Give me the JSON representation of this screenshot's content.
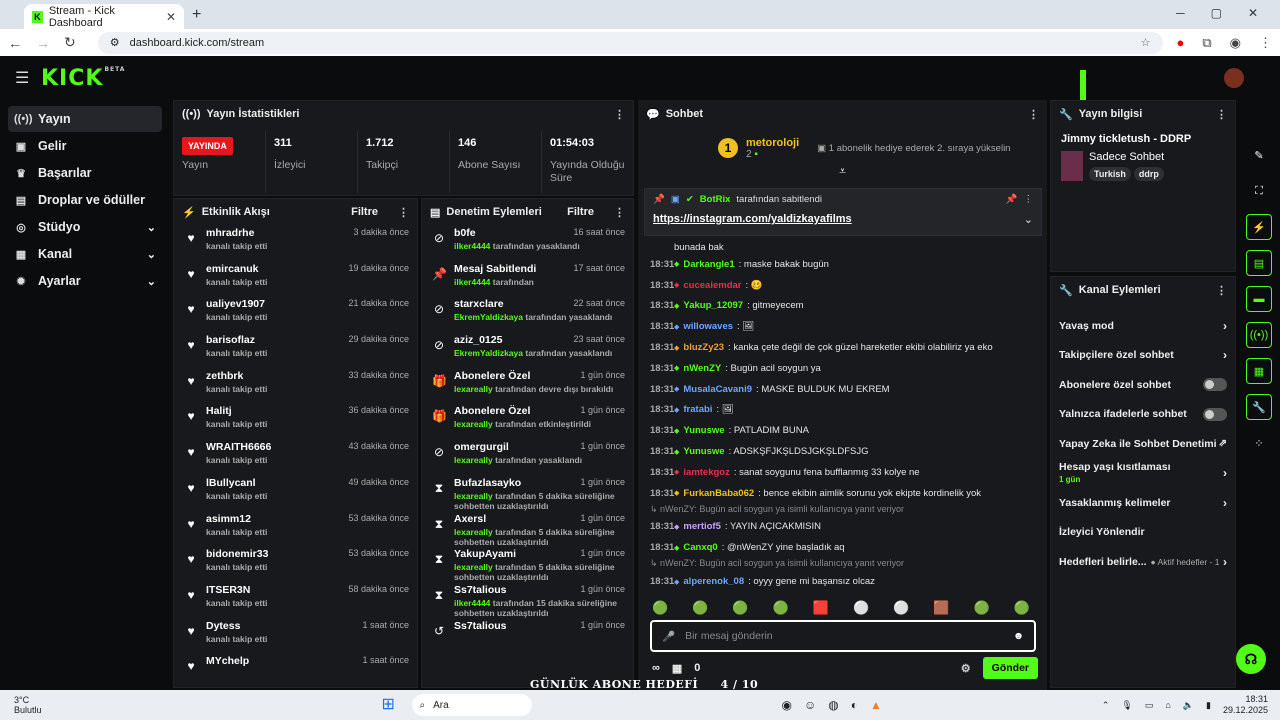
{
  "browser": {
    "tab_title": "Stream - Kick Dashboard",
    "url": "dashboard.kick.com/stream"
  },
  "brand": {
    "logo": "KICK",
    "beta": "BETA",
    "accent": "#53fc18"
  },
  "sidebar": {
    "items": [
      {
        "label": "Yayın",
        "icon": "broadcast-icon"
      },
      {
        "label": "Gelir",
        "icon": "money-icon"
      },
      {
        "label": "Başarılar",
        "icon": "trophy-icon"
      },
      {
        "label": "Droplar ve ödüller",
        "icon": "gift-icon"
      },
      {
        "label": "Stüdyo",
        "icon": "studio-icon"
      },
      {
        "label": "Kanal",
        "icon": "channel-icon"
      },
      {
        "label": "Ayarlar",
        "icon": "gear-icon"
      }
    ]
  },
  "stats_panel": {
    "title": "Yayın İstatistikleri",
    "live_badge": "YAYINDA",
    "live_label": "Yayın",
    "stats": [
      {
        "value": "311",
        "label": "İzleyici"
      },
      {
        "value": "1.712",
        "label": "Takipçi"
      },
      {
        "value": "146",
        "label": "Abone Sayısı"
      },
      {
        "value": "01:54:03",
        "label": "Yayında Olduğu Süre"
      }
    ]
  },
  "activity_feed": {
    "title": "Etkinlik Akışı",
    "filter": "Filtre",
    "items": [
      {
        "name": "mhradrhe",
        "sub": "kanalı takip etti",
        "time": "3 dakika önce"
      },
      {
        "name": "emircanuk",
        "sub": "kanalı takip etti",
        "time": "19 dakika önce"
      },
      {
        "name": "ualiyev1907",
        "sub": "kanalı takip etti",
        "time": "21 dakika önce"
      },
      {
        "name": "barisoflaz",
        "sub": "kanalı takip etti",
        "time": "29 dakika önce"
      },
      {
        "name": "zethbrk",
        "sub": "kanalı takip etti",
        "time": "33 dakika önce"
      },
      {
        "name": "Halitj",
        "sub": "kanalı takip etti",
        "time": "36 dakika önce"
      },
      {
        "name": "WRAITH6666",
        "sub": "kanalı takip etti",
        "time": "43 dakika önce"
      },
      {
        "name": "lBullycanl",
        "sub": "kanalı takip etti",
        "time": "49 dakika önce"
      },
      {
        "name": "asimm12",
        "sub": "kanalı takip etti",
        "time": "53 dakika önce"
      },
      {
        "name": "bidonemir33",
        "sub": "kanalı takip etti",
        "time": "53 dakika önce"
      },
      {
        "name": "ITSER3N",
        "sub": "kanalı takip etti",
        "time": "58 dakika önce"
      },
      {
        "name": "Dytess",
        "sub": "kanalı takip etti",
        "time": "1 saat önce"
      },
      {
        "name": "MYchelp",
        "sub": "",
        "time": "1 saat önce"
      }
    ]
  },
  "mod_actions": {
    "title": "Denetim Eylemleri",
    "filter": "Filtre",
    "items": [
      {
        "name": "b0fe",
        "actor": "ilker4444",
        "action": "tarafından yasaklandı",
        "time": "16 saat önce",
        "icon": "ban-icon"
      },
      {
        "name": "Mesaj Sabitlendi",
        "actor": "ilker4444",
        "action": "tarafından",
        "time": "17 saat önce",
        "icon": "pin-icon"
      },
      {
        "name": "starxclare",
        "actor": "EkremYaldizkaya",
        "action": "tarafından yasaklandı",
        "time": "22 saat önce",
        "icon": "ban-icon"
      },
      {
        "name": "aziz_0125",
        "actor": "EkremYaldizkaya",
        "action": "tarafından yasaklandı",
        "time": "23 saat önce",
        "icon": "ban-icon"
      },
      {
        "name": "Abonelere Özel",
        "actor": "lexareally",
        "action": "tarafından devre dışı bırakıldı",
        "time": "1 gün önce",
        "icon": "gift-icon"
      },
      {
        "name": "Abonelere Özel",
        "actor": "lexareally",
        "action": "tarafından etkinleştirildi",
        "time": "1 gün önce",
        "icon": "gift-icon"
      },
      {
        "name": "omergurgil",
        "actor": "lexareally",
        "action": "tarafından yasaklandı",
        "time": "1 gün önce",
        "icon": "ban-icon"
      },
      {
        "name": "Bufazlasayko",
        "actor": "lexareally",
        "action": "tarafından 5 dakika süreliğine sohbetten uzaklaştırıldı",
        "time": "1 gün önce",
        "icon": "hourglass-icon"
      },
      {
        "name": "Axersl",
        "actor": "lexareally",
        "action": "tarafından 5 dakika süreliğine sohbetten uzaklaştırıldı",
        "time": "1 gün önce",
        "icon": "hourglass-icon"
      },
      {
        "name": "YakupAyami",
        "actor": "lexareally",
        "action": "tarafından 5 dakika süreliğine sohbetten uzaklaştırıldı",
        "time": "1 gün önce",
        "icon": "hourglass-icon"
      },
      {
        "name": "Ss7talious",
        "actor": "ilker4444",
        "action": "tarafından 15 dakika süreliğine sohbetten uzaklaştırıldı",
        "time": "1 gün önce",
        "icon": "hourglass-icon"
      },
      {
        "name": "Ss7talious",
        "actor": "",
        "action": "",
        "time": "1 gün önce",
        "icon": "undo-icon"
      }
    ]
  },
  "chat": {
    "title": "Sohbet",
    "top_sub": {
      "name": "metorolojі",
      "count": "2",
      "message": "1 abonelik hediye ederek 2. sıraya yükselin"
    },
    "pinned": {
      "by": "BotRix",
      "by_suffix": "tarafından sabitlendi",
      "link": "https://instagram.com/yaldizkayafilms"
    },
    "messages": [
      {
        "type": "msg",
        "time": "",
        "user": "",
        "color": "#e6e6e6",
        "text": "bunada bak"
      },
      {
        "type": "msg",
        "time": "18:31",
        "user": "Darkangle1",
        "color": "#53fc18",
        "text": ": maske bakak bugün"
      },
      {
        "type": "msg",
        "time": "18:31",
        "user": "cuceaiemdar",
        "color": "#e8304a",
        "text": ": 🥴"
      },
      {
        "type": "msg",
        "time": "18:31",
        "user": "Yakup_12097",
        "color": "#53fc18",
        "text": ": gitmeyecem"
      },
      {
        "type": "msg",
        "time": "18:31",
        "user": "willowaves",
        "color": "#6ea6ff",
        "text": ": 🖼"
      },
      {
        "type": "msg",
        "time": "18:31",
        "user": "bluzZy23",
        "color": "#f0a030",
        "text": ": kanka çete değil de çok güzel hareketler ekibi olabiliriz ya eko"
      },
      {
        "type": "msg",
        "time": "18:31",
        "user": "nWenZY",
        "color": "#53fc18",
        "text": ": Bugün acil soygun ya"
      },
      {
        "type": "msg",
        "time": "18:31",
        "user": "MusalaCavani9",
        "color": "#6ea6ff",
        "text": ": MASKE BULDUK MU EKREM"
      },
      {
        "type": "msg",
        "time": "18:31",
        "user": "fratabi",
        "color": "#6ea6ff",
        "text": ": 🖼"
      },
      {
        "type": "msg",
        "time": "18:31",
        "user": "Yunuswe",
        "color": "#53fc18",
        "text": ": PATLADIM BUNA"
      },
      {
        "type": "msg",
        "time": "18:31",
        "user": "Yunuswe",
        "color": "#53fc18",
        "text": ": ADSKŞFJKŞLDSJGKŞLDFSJG"
      },
      {
        "type": "msg",
        "time": "18:31",
        "user": "iamtekgoz",
        "color": "#e8304a",
        "text": ": sanat soygunu fena bufflanmış 33 kolye ne"
      },
      {
        "type": "msg",
        "time": "18:31",
        "user": "FurkanBaba062",
        "color": "#f0c020",
        "text": ": bence ekibin aimlik sorunu yok ekipte kordinelik yok"
      },
      {
        "type": "reply",
        "text": "↳ nWenZY: Bugün acil soygun ya isimli kullanıcıya yanıt veriyor"
      },
      {
        "type": "msg",
        "time": "18:31",
        "user": "mertiof5",
        "color": "#c8a0ff",
        "text": ": YAYIN AÇICAKMISIN"
      },
      {
        "type": "msg",
        "time": "18:31",
        "user": "Canxq0",
        "color": "#53fc18",
        "text": ": @nWenZY yine başladık aq"
      },
      {
        "type": "reply",
        "text": "↳ nWenZY: Bugün acil soygun ya isimli kullanıcıya yanıt veriyor"
      },
      {
        "type": "msg",
        "time": "18:31",
        "user": "alperenok_08",
        "color": "#6ea6ff",
        "text": ": oyyy gene mi başansız olcaz"
      }
    ],
    "emotes": [
      "🟢",
      "🟢",
      "🟢",
      "🟢",
      "🟥",
      "⚪",
      "⚪",
      "🟫",
      "🟢",
      "🟢"
    ],
    "input_placeholder": "Bir mesaj gönderin",
    "points": "0",
    "send": "Gönder"
  },
  "stream_info": {
    "title": "Yayın bilgisi",
    "stream_title": "Jimmy tickletush - DDRP",
    "category": "Sadece Sohbet",
    "tags": [
      "Turkish",
      "ddrp"
    ]
  },
  "channel_actions": {
    "title": "Kanal Eylemleri",
    "items": [
      {
        "label": "Yavaş mod",
        "kind": "chevron"
      },
      {
        "label": "Takipçilere özel sohbet",
        "kind": "chevron"
      },
      {
        "label": "Abonelere özel sohbet",
        "kind": "toggle"
      },
      {
        "label": "Yalnızca ifadelerle sohbet",
        "kind": "toggle"
      },
      {
        "label": "Yapay Zeka ile Sohbet Denetimi",
        "kind": "external"
      },
      {
        "label": "Hesap yaşı kısıtlaması",
        "kind": "chevron",
        "sub": "1 gün"
      },
      {
        "label": "Yasaklanmış kelimeler",
        "kind": "chevron"
      },
      {
        "label": "İzleyici Yönlendir",
        "kind": "none"
      },
      {
        "label": "Hedefleri belirle...",
        "kind": "chevron",
        "extra": "● Aktif hedefler - 1"
      }
    ]
  },
  "overlay": {
    "banner": "GÜNLÜK ABONE HEDEFİ",
    "progress": "4 / 10"
  },
  "taskbar": {
    "weather_temp": "3°C",
    "weather_desc": "Bulutlu",
    "search": "Ara",
    "time": "18:31",
    "date": "29.12.2025"
  }
}
